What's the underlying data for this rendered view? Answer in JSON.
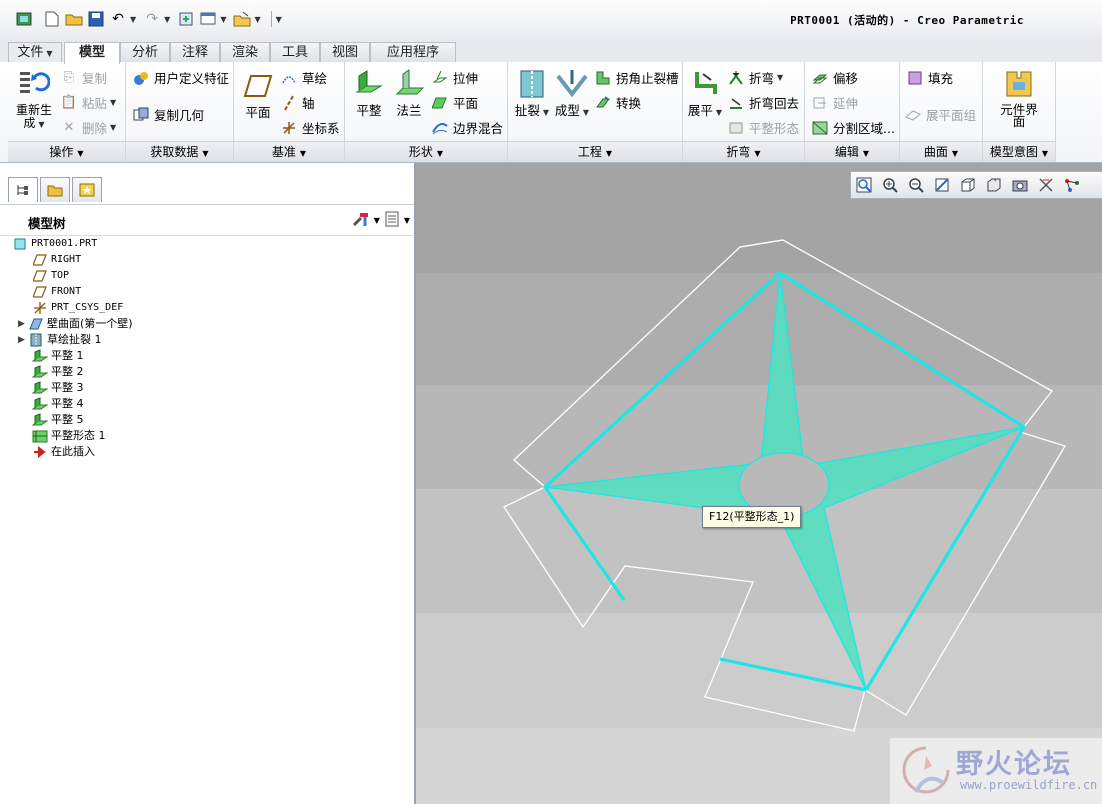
{
  "window": {
    "title": "PRT0001 (活动的) - Creo Parametric"
  },
  "ribbon": {
    "tabs": [
      "文件",
      "模型",
      "分析",
      "注释",
      "渲染",
      "工具",
      "视图",
      "应用程序"
    ],
    "active_tab": "模型",
    "groups": {
      "operations": {
        "label": "操作",
        "regenerate": "重新生成",
        "copy": "复制",
        "paste": "粘贴",
        "delete": "删除"
      },
      "get_data": {
        "label": "获取数据",
        "udf": "用户定义特征",
        "copy_geom": "复制几何"
      },
      "datum": {
        "label": "基准",
        "plane": "平面",
        "sketch": "草绘",
        "axis": "轴",
        "csys": "坐标系"
      },
      "shapes": {
        "label": "形状",
        "flat": "平整",
        "flange": "法兰",
        "extrude": "拉伸",
        "planar": "平面",
        "boundary_blend": "边界混合"
      },
      "engineering": {
        "label": "工程",
        "rip": "扯裂",
        "form": "成型",
        "corner_relief": "拐角止裂槽",
        "convert": "转换"
      },
      "bends": {
        "label": "折弯",
        "unbend": "展平",
        "bend": "折弯",
        "bend_back": "折弯回去",
        "flat_state": "平整形态"
      },
      "editing": {
        "label": "编辑",
        "offset": "偏移",
        "extend": "延伸",
        "split_area": "分割区域..."
      },
      "surfaces": {
        "label": "曲面",
        "fill": "填充",
        "flatten_quilt": "展平面组"
      },
      "model_intent": {
        "label": "模型意图",
        "component_interface": "元件界面"
      }
    }
  },
  "model_tree": {
    "label": "模型树",
    "items": [
      {
        "label": "PRT0001.PRT",
        "icon": "part-icon"
      },
      {
        "label": "RIGHT",
        "icon": "datum-plane-icon"
      },
      {
        "label": "TOP",
        "icon": "datum-plane-icon"
      },
      {
        "label": "FRONT",
        "icon": "datum-plane-icon"
      },
      {
        "label": "PRT_CSYS_DEF",
        "icon": "csys-icon"
      },
      {
        "label": "壁曲面(第一个壁)",
        "icon": "wall-icon"
      },
      {
        "label": "草绘扯裂 1",
        "icon": "rip-icon"
      },
      {
        "label": "平整 1",
        "icon": "flat-wall-icon"
      },
      {
        "label": "平整 2",
        "icon": "flat-wall-icon"
      },
      {
        "label": "平整 3",
        "icon": "flat-wall-icon"
      },
      {
        "label": "平整 4",
        "icon": "flat-wall-icon"
      },
      {
        "label": "平整 5",
        "icon": "flat-wall-icon"
      },
      {
        "label": "平整形态 1",
        "icon": "flat-state-icon"
      },
      {
        "label": "在此插入",
        "icon": "insert-arrow-icon"
      }
    ]
  },
  "viewport": {
    "tooltip": "F12(平整形态_1)"
  },
  "watermark": {
    "cn": "野火论坛",
    "url": "www.proewildfire.cn"
  },
  "colors": {
    "highlight": "#00e0e0",
    "fill": "#4fe0c0",
    "edge": "#ffffff"
  }
}
